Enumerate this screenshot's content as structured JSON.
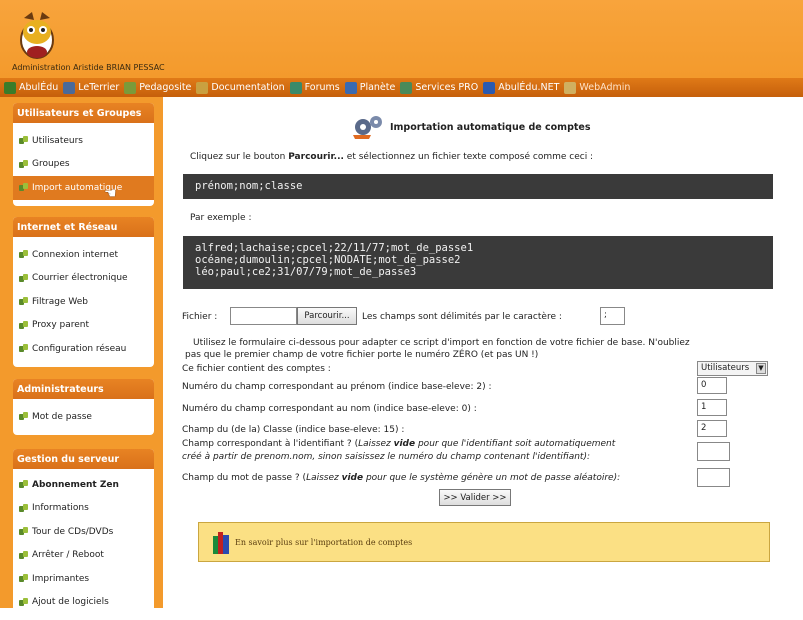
{
  "header": {
    "admin_text": "Administration Aristide BRIAN PESSAC"
  },
  "nav": {
    "items": [
      {
        "label": "AbulÉdu",
        "color": "#3a7c2a"
      },
      {
        "label": "LeTerrier",
        "color": "#4a6a9a"
      },
      {
        "label": "Pedagosite",
        "color": "#7a9a3a"
      },
      {
        "label": "Documentation",
        "color": "#c9a040"
      },
      {
        "label": "Forums",
        "color": "#3a8a6a"
      },
      {
        "label": "Planète",
        "color": "#3a6ab0"
      },
      {
        "label": "Services PRO",
        "color": "#4a8a5a"
      },
      {
        "label": "AbulÉdu.NET",
        "color": "#2a5ab0"
      },
      {
        "label": "WebAdmin",
        "color": "#d0b060"
      }
    ]
  },
  "sidebar": {
    "groups": [
      {
        "title": "Utilisateurs et Groupes",
        "items": [
          "Utilisateurs",
          "Groupes",
          "Import automatique"
        ]
      },
      {
        "title": "Internet et Réseau",
        "items": [
          "Connexion internet",
          "Courrier électronique",
          "Filtrage Web",
          "Proxy parent",
          "Configuration réseau"
        ]
      },
      {
        "title": "Administrateurs",
        "items": [
          "Mot de passe"
        ]
      },
      {
        "title": "Gestion du serveur",
        "items": [
          "Abonnement Zen",
          "Informations",
          "Tour de CDs/DVDs",
          "Arrêter / Reboot",
          "Imprimantes",
          "Ajout de logiciels"
        ]
      }
    ]
  },
  "main": {
    "title": "Importation automatique de comptes",
    "intro_before": "Cliquez sur le bouton ",
    "intro_bold": "Parcourir...",
    "intro_after": " et sélectionnez un fichier texte composé comme ceci :",
    "format_line": "prénom;nom;classe",
    "example_label": "Par exemple :",
    "example_lines": [
      "alfred;lachaise;cpcel;22/11/77;mot_de_passe1",
      "océane;dumoulin;cpcel;NODATE;mot_de_passe2",
      "léo;paul;ce2;31/07/79;mot_de_passe3"
    ],
    "file_label": "Fichier :",
    "browse_button": "Parcourir...",
    "delim_label": "Les champs sont délimités par le caractère :",
    "delim_value": ";",
    "help_line1": "Utilisez le formulaire ci-dessous pour adapter ce script d'import en fonction de votre fichier de base. N'oubliez",
    "help_line2": "pas que le premier champ de votre fichier porte le numéro ZÉRO (et pas UN !)",
    "contains_label": "Ce fichier contient des comptes :",
    "contains_value": "Utilisateurs",
    "field_firstname_label": "Numéro du champ correspondant au prénom (indice base-eleve: 2) :",
    "field_firstname_value": "0",
    "field_name_label": "Numéro du champ correspondant au nom (indice base-eleve: 0) :",
    "field_name_value": "1",
    "field_class_label": "Champ du (de la) Classe (indice base-eleve: 15) :",
    "field_class_value": "2",
    "id_label_1a": "Champ correspondant à l'identifiant ? (",
    "id_label_1b": "Laissez ",
    "id_label_1c": "vide",
    "id_label_1d": " pour que l'identifiant soit automatiquement",
    "id_label_2": "créé à partir de prenom.nom, sinon saisissez le numéro du champ contenant l'identifiant):",
    "pwd_label_a": "Champ du mot de passe ? (",
    "pwd_label_b": "Laissez ",
    "pwd_label_c": "vide",
    "pwd_label_d": " pour que le système génère un mot de passe aléatoire):",
    "validate_button": ">> Valider >>",
    "help_link": "En savoir plus sur l'importation de comptes"
  }
}
